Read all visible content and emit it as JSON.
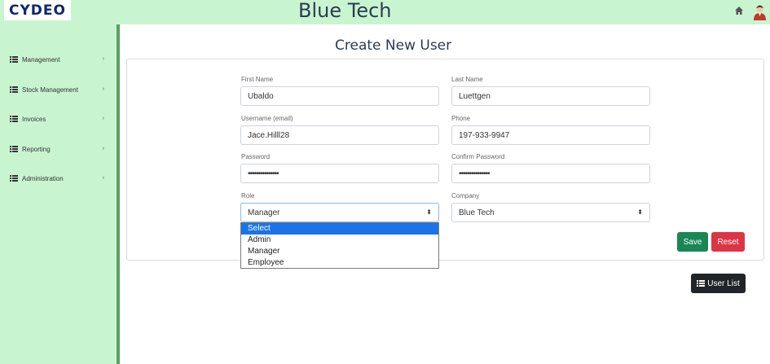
{
  "header": {
    "logo_text": "CYDEO",
    "app_title": "Blue Tech",
    "home_icon": "home-icon",
    "avatar_icon": "user-avatar"
  },
  "sidebar": {
    "items": [
      {
        "label": "Management",
        "icon": "list-icon"
      },
      {
        "label": "Stock Management",
        "icon": "list-icon"
      },
      {
        "label": "Invoices",
        "icon": "list-icon"
      },
      {
        "label": "Reporting",
        "icon": "list-icon"
      },
      {
        "label": "Administration",
        "icon": "list-icon"
      }
    ]
  },
  "page": {
    "heading": "Create New User"
  },
  "form": {
    "first_name": {
      "label": "First Name",
      "value": "Ubaldo"
    },
    "last_name": {
      "label": "Last Name",
      "value": "Luettgen"
    },
    "username": {
      "label": "Username (email)",
      "value": "Jace.Hilll28"
    },
    "phone": {
      "label": "Phone",
      "value": "197-933-9947"
    },
    "password": {
      "label": "Password",
      "value": "•••••••••••••••"
    },
    "confirm_password": {
      "label": "Confirm Password",
      "value": "•••••••••••••••"
    },
    "role": {
      "label": "Role",
      "value": "Manager",
      "options": [
        "Select",
        "Admin",
        "Manager",
        "Employee"
      ]
    },
    "company": {
      "label": "Company",
      "value": "Blue Tech"
    },
    "save_label": "Save",
    "reset_label": "Reset"
  },
  "actions": {
    "user_list_label": "User List"
  },
  "colors": {
    "header_bg": "#c8f5d0",
    "save": "#198754",
    "reset": "#dc3545",
    "user_list": "#212529",
    "highlight": "#1a73e8"
  }
}
